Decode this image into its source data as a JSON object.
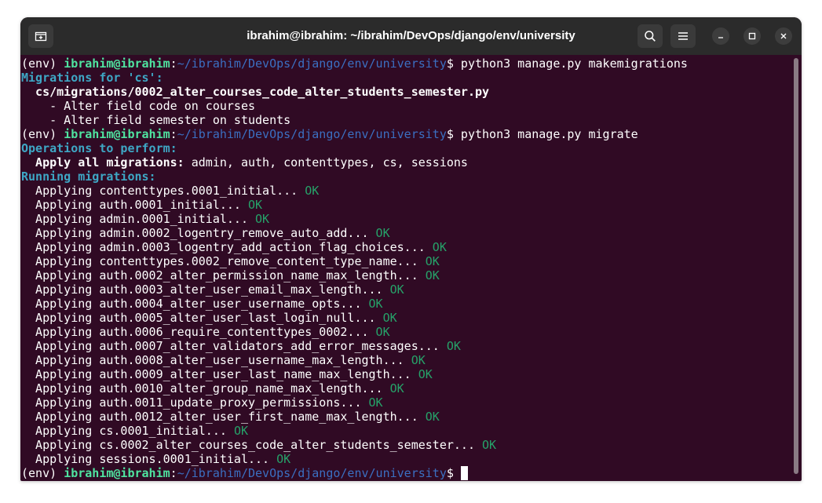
{
  "window": {
    "title": "ibrahim@ibrahim: ~/ibrahim/DevOps/django/env/university",
    "buttons": {
      "new_tab_icon": "new-tab-icon",
      "search_icon": "search-icon",
      "menu_icon": "hamburger-menu-icon",
      "minimize_icon": "minimize-icon",
      "maximize_icon": "maximize-icon",
      "close_icon": "close-icon"
    }
  },
  "prompt": {
    "env": "(env) ",
    "user_host": "ibrahim@ibrahim",
    "colon": ":",
    "path": "~/ibrahim/DevOps/django/env/university",
    "dollar": "$ "
  },
  "commands": {
    "makemigrations": "python3 manage.py makemigrations",
    "migrate": "python3 manage.py migrate"
  },
  "makemigrations_output": {
    "header": "Migrations for 'cs':",
    "file": "  cs/migrations/0002_alter_courses_code_alter_students_semester.py",
    "ops": [
      "    - Alter field code on courses",
      "    - Alter field semester on students"
    ]
  },
  "migrate_output": {
    "ops_header": "Operations to perform:",
    "apply_label": "  Apply all migrations:",
    "apply_apps": " admin, auth, contenttypes, cs, sessions",
    "running_header": "Running migrations:",
    "ok_label": "OK",
    "migrations": [
      "  Applying contenttypes.0001_initial... ",
      "  Applying auth.0001_initial... ",
      "  Applying admin.0001_initial... ",
      "  Applying admin.0002_logentry_remove_auto_add... ",
      "  Applying admin.0003_logentry_add_action_flag_choices... ",
      "  Applying contenttypes.0002_remove_content_type_name... ",
      "  Applying auth.0002_alter_permission_name_max_length... ",
      "  Applying auth.0003_alter_user_email_max_length... ",
      "  Applying auth.0004_alter_user_username_opts... ",
      "  Applying auth.0005_alter_user_last_login_null... ",
      "  Applying auth.0006_require_contenttypes_0002... ",
      "  Applying auth.0007_alter_validators_add_error_messages... ",
      "  Applying auth.0008_alter_user_username_max_length... ",
      "  Applying auth.0009_alter_user_last_name_max_length... ",
      "  Applying auth.0010_alter_group_name_max_length... ",
      "  Applying auth.0011_update_proxy_permissions... ",
      "  Applying auth.0012_alter_user_first_name_max_length... ",
      "  Applying cs.0001_initial... ",
      "  Applying cs.0002_alter_courses_code_alter_students_semester... ",
      "  Applying sessions.0001_initial... "
    ]
  },
  "colors": {
    "terminal_bg": "#300a24",
    "titlebar_bg": "#2b2b2b",
    "user_host": "#4fe4a0",
    "path": "#3b6fc1",
    "header": "#3ea7c5",
    "ok": "#26a269"
  }
}
